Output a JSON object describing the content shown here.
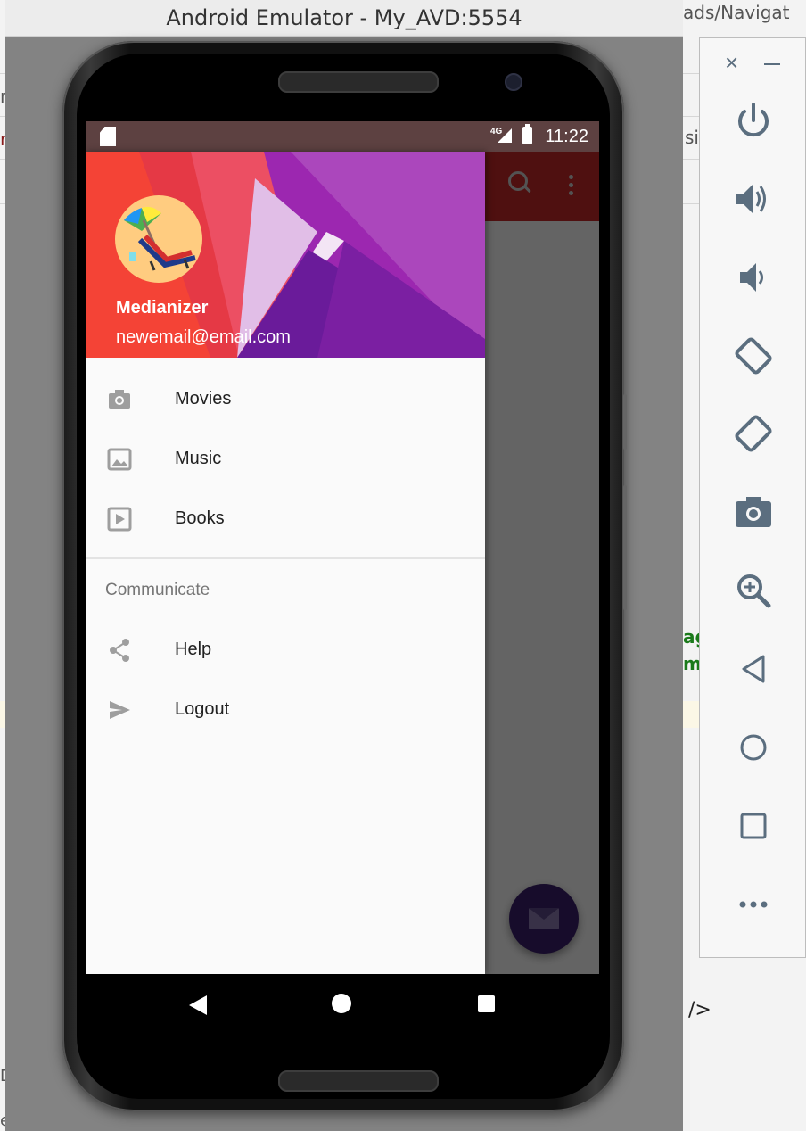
{
  "window": {
    "title": "Android Emulator - My_AVD:5554"
  },
  "background_ide": {
    "fragments": [
      "ads/Navigat",
      "n",
      "r",
      "sic",
      "ag",
      "ma",
      "/>",
      "Do",
      "eg"
    ]
  },
  "status_bar": {
    "network": "4G",
    "time": "11:22"
  },
  "toolbar": {
    "icons": [
      "search-icon",
      "more-vert-icon"
    ]
  },
  "drawer": {
    "header": {
      "name": "Medianizer",
      "email": "newemail@email.com"
    },
    "items": [
      {
        "label": "Movies",
        "icon": "camera-icon"
      },
      {
        "label": "Music",
        "icon": "gallery-icon"
      },
      {
        "label": "Books",
        "icon": "slideshow-icon"
      }
    ],
    "section_title": "Communicate",
    "section_items": [
      {
        "label": "Help",
        "icon": "share-icon"
      },
      {
        "label": "Logout",
        "icon": "send-icon"
      }
    ]
  },
  "fab": {
    "icon": "email-icon"
  },
  "nav_bar": {
    "icons": [
      "back-icon",
      "home-icon",
      "recents-icon"
    ]
  },
  "side_panel": {
    "controls": [
      "power-icon",
      "volume-up-icon",
      "volume-down-icon",
      "rotate-left-icon",
      "rotate-right-icon",
      "screenshot-icon",
      "zoom-icon",
      "back-icon",
      "home-icon",
      "overview-icon",
      "more-icon"
    ]
  },
  "colors": {
    "toolbar": "#c62828",
    "drawer_header": "#8e24aa",
    "fab": "#3a1f6b",
    "panel_icon": "#5b6e7f"
  }
}
